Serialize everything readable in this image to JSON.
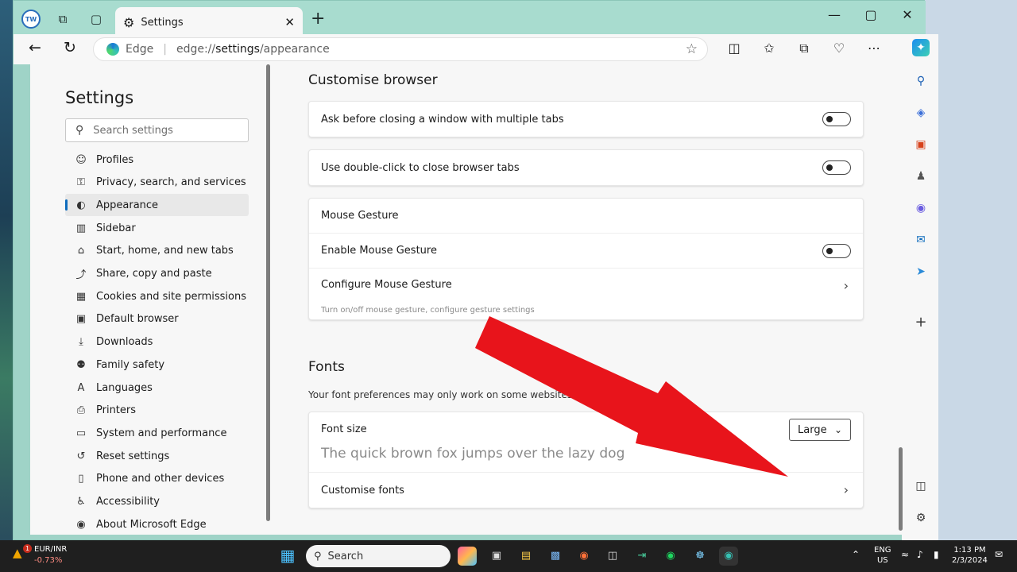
{
  "browser": {
    "tab_title": "Settings",
    "address_prefix": "Edge",
    "address_url_scheme": "edge://",
    "address_url_host": "settings",
    "address_url_path": "/appearance"
  },
  "settings": {
    "title": "Settings",
    "search_placeholder": "Search settings",
    "nav": [
      {
        "label": "Profiles",
        "icon": "person-icon"
      },
      {
        "label": "Privacy, search, and services",
        "icon": "lock-icon"
      },
      {
        "label": "Appearance",
        "icon": "palette-icon"
      },
      {
        "label": "Sidebar",
        "icon": "sidebar-icon"
      },
      {
        "label": "Start, home, and new tabs",
        "icon": "home-icon"
      },
      {
        "label": "Share, copy and paste",
        "icon": "share-icon"
      },
      {
        "label": "Cookies and site permissions",
        "icon": "cookie-icon"
      },
      {
        "label": "Default browser",
        "icon": "browser-icon"
      },
      {
        "label": "Downloads",
        "icon": "download-icon"
      },
      {
        "label": "Family safety",
        "icon": "family-icon"
      },
      {
        "label": "Languages",
        "icon": "language-icon"
      },
      {
        "label": "Printers",
        "icon": "printer-icon"
      },
      {
        "label": "System and performance",
        "icon": "laptop-icon"
      },
      {
        "label": "Reset settings",
        "icon": "reset-icon"
      },
      {
        "label": "Phone and other devices",
        "icon": "phone-icon"
      },
      {
        "label": "Accessibility",
        "icon": "accessibility-icon"
      },
      {
        "label": "About Microsoft Edge",
        "icon": "edge-icon"
      }
    ],
    "active_nav": "Appearance"
  },
  "main": {
    "customise_heading": "Customise browser",
    "ask_close": "Ask before closing a window with multiple tabs",
    "double_click": "Use double-click to close browser tabs",
    "mouse_gesture_title": "Mouse Gesture",
    "enable_mouse_gesture": "Enable Mouse Gesture",
    "configure_mouse_gesture": "Configure Mouse Gesture",
    "configure_sub": "Turn on/off mouse gesture, configure gesture settings",
    "fonts_heading": "Fonts",
    "fonts_note": "Your font preferences may only work on some websites",
    "font_size_label": "Font size",
    "font_size_value": "Large",
    "font_sample": "The quick brown fox jumps over the lazy dog",
    "customise_fonts": "Customise fonts"
  },
  "taskbar": {
    "ticker_name": "EUR/INR",
    "ticker_change": "-0.73%",
    "ticker_badge": "1",
    "search_label": "Search",
    "lang_top": "ENG",
    "lang_bottom": "US",
    "time": "1:13 PM",
    "date": "2/3/2024"
  },
  "colors": {
    "arrow": "#e8141b",
    "accent": "#0f6cbd",
    "frame": "#a8dccf"
  }
}
